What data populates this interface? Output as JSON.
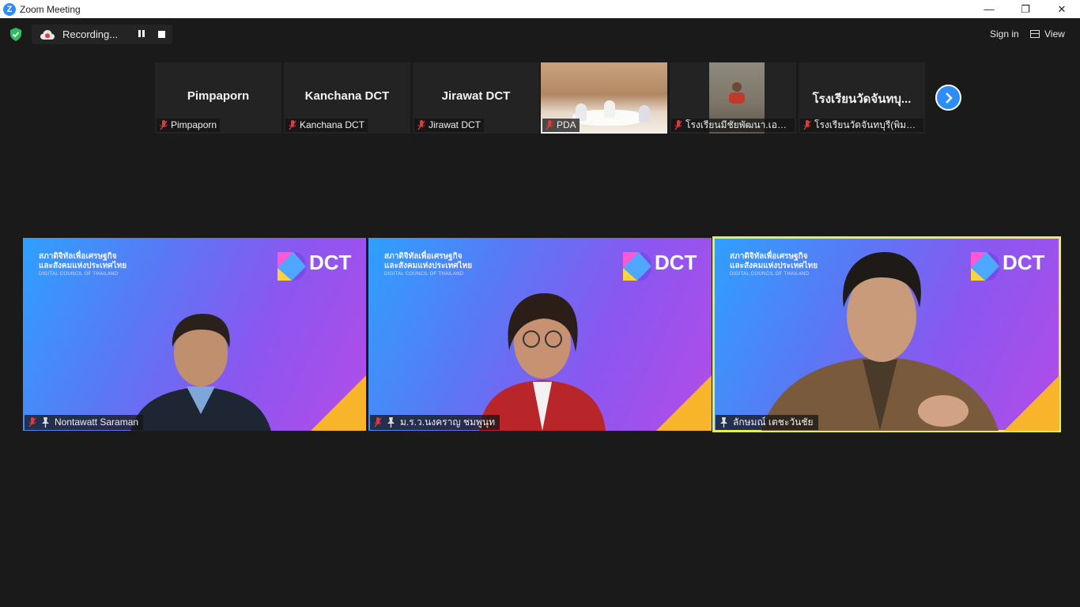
{
  "window": {
    "title": "Zoom Meeting",
    "app_icon_glyph": "Z",
    "controls": {
      "minimize": "—",
      "restore": "❐",
      "close": "✕"
    }
  },
  "toolbar": {
    "recording_label": "Recording...",
    "signin_label": "Sign in",
    "view_label": "View"
  },
  "colors": {
    "accent": "#2d8cff",
    "muted_red": "#e03c3c",
    "active_speaker": "#e6f04b",
    "shield_green": "#2dbe60"
  },
  "thumbnails": [
    {
      "name": "Pimpaporn",
      "label": "Pimpaporn",
      "video": false
    },
    {
      "name": "Kanchana DCT",
      "label": "Kanchana DCT",
      "video": false
    },
    {
      "name": "Jirawat DCT",
      "label": "Jirawat DCT",
      "video": false
    },
    {
      "name": "",
      "label": "PDA",
      "video": true
    },
    {
      "name": "",
      "label": "โรงเรียนมีชัยพัฒนา.เอกชัย",
      "video": true
    },
    {
      "name": "โรงเรียนวัดจันทบุ...",
      "label": "โรงเรียนวัดจันทบุรี(พิมพ์ป...",
      "video": false
    }
  ],
  "main_tiles": [
    {
      "label": "Nontawatt Saraman",
      "mic_muted": true,
      "pinned": true,
      "active": false,
      "brand_th_1": "สภาดิจิทัลเพื่อเศรษฐกิจ",
      "brand_th_2": "และสังคมแห่งประเทศไทย",
      "brand_en": "DIGITAL COUNCIL OF THAILAND",
      "logo_text": "DCT"
    },
    {
      "label": "ม.ร.ว.นงคราญ ชมพูนุท",
      "mic_muted": true,
      "pinned": true,
      "active": false,
      "brand_th_1": "สภาดิจิทัลเพื่อเศรษฐกิจ",
      "brand_th_2": "และสังคมแห่งประเทศไทย",
      "brand_en": "DIGITAL COUNCIL OF THAILAND",
      "logo_text": "DCT"
    },
    {
      "label": "ลักษมณ์ เตชะวันชัย",
      "mic_muted": false,
      "pinned": true,
      "active": true,
      "brand_th_1": "สภาดิจิทัลเพื่อเศรษฐกิจ",
      "brand_th_2": "และสังคมแห่งประเทศไทย",
      "brand_en": "DIGITAL COUNCIL OF THAILAND",
      "logo_text": "DCT"
    }
  ]
}
